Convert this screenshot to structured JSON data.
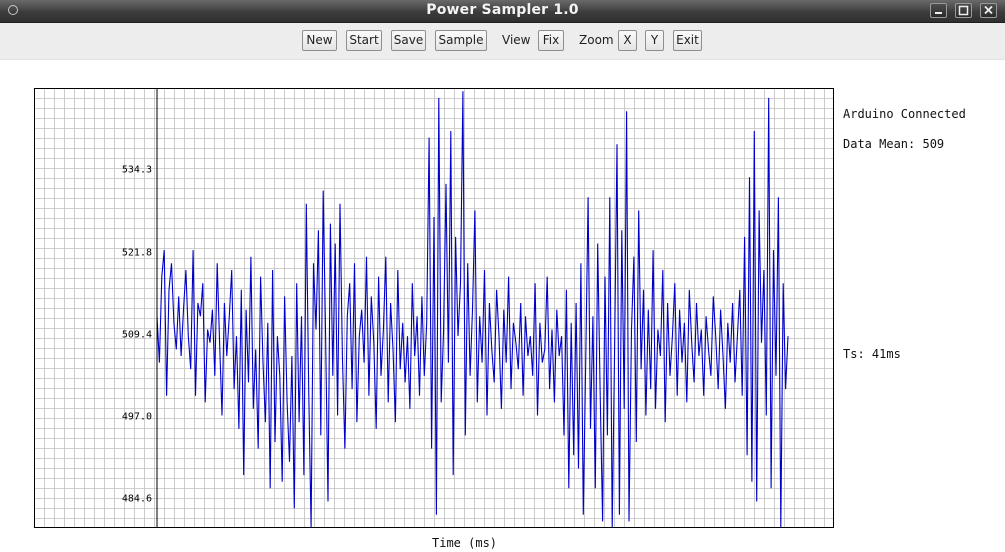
{
  "window": {
    "title": "Power Sampler 1.0"
  },
  "toolbar": {
    "new": "New",
    "start": "Start",
    "save": "Save",
    "sample": "Sample",
    "view_label": "View",
    "fix": "Fix",
    "zoom_label": "Zoom",
    "zoom_x": "X",
    "zoom_y": "Y",
    "exit": "Exit"
  },
  "status": {
    "connection": "Arduino Connected",
    "mean": "Data Mean: 509",
    "ts": "Ts: 41ms"
  },
  "colors": {
    "trace": "#0000cc",
    "grid": "#c0c0c0",
    "axis": "#000000"
  },
  "chart_data": {
    "type": "line",
    "xlabel": "Time (ms)",
    "ylabel": "",
    "ylim": [
      480,
      546.5
    ],
    "yticks": [
      "534.3",
      "521.8",
      "509.4",
      "497.0",
      "484.6"
    ],
    "ytick_values": [
      534.3,
      521.8,
      509.4,
      497.0,
      484.6
    ],
    "grid": true,
    "series": [
      {
        "values": [
          512,
          505,
          518,
          522,
          500,
          516,
          520,
          511,
          507,
          515,
          506,
          513,
          519,
          509,
          504,
          522,
          500,
          514,
          512,
          517,
          499,
          510,
          508,
          513,
          503,
          520,
          508,
          497,
          514,
          506,
          512,
          519,
          501,
          509,
          495,
          516,
          488,
          513,
          502,
          521,
          498,
          507,
          492,
          518,
          505,
          496,
          511,
          486,
          519,
          493,
          509,
          503,
          487,
          515,
          499,
          490,
          506,
          483,
          517,
          496,
          512,
          488,
          529,
          501,
          480,
          520,
          510,
          525,
          494,
          531,
          509,
          484,
          526,
          503,
          523,
          497,
          529,
          506,
          492,
          512,
          517,
          501,
          520,
          496,
          509,
          513,
          505,
          521,
          500,
          515,
          508,
          495,
          518,
          503,
          510,
          521,
          499,
          514,
          507,
          496,
          519,
          504,
          511,
          502,
          509,
          498,
          517,
          506,
          512,
          500,
          515,
          503,
          511,
          539,
          492,
          527,
          482,
          545,
          499,
          510,
          532,
          505,
          540,
          488,
          524,
          509,
          517,
          546,
          494,
          520,
          503,
          513,
          528,
          499,
          512,
          505,
          519,
          497,
          514,
          507,
          502,
          516,
          509,
          498,
          513,
          505,
          518,
          501,
          511,
          508,
          504,
          514,
          500,
          512,
          506,
          509,
          503,
          517,
          497,
          511,
          505,
          507,
          518,
          501,
          510,
          499,
          513,
          506,
          509,
          494,
          516,
          486,
          511,
          491,
          514,
          489,
          520,
          482,
          505,
          530,
          495,
          512,
          486,
          523,
          501,
          481,
          518,
          494,
          530,
          480,
          507,
          538,
          482,
          525,
          498,
          543,
          481,
          510,
          521,
          493,
          528,
          504,
          516,
          497,
          513,
          501,
          522,
          498,
          510,
          506,
          519,
          496,
          514,
          503,
          509,
          517,
          500,
          513,
          505,
          511,
          499,
          516,
          508,
          502,
          514,
          506,
          510,
          500,
          512,
          507,
          503,
          515,
          509,
          501,
          513,
          506,
          498,
          511,
          505,
          514,
          502,
          509,
          516,
          500,
          524,
          491,
          533,
          487,
          540,
          484,
          528,
          508,
          519,
          497,
          545,
          486,
          522,
          503,
          530,
          480,
          517,
          501,
          509
        ]
      }
    ]
  }
}
